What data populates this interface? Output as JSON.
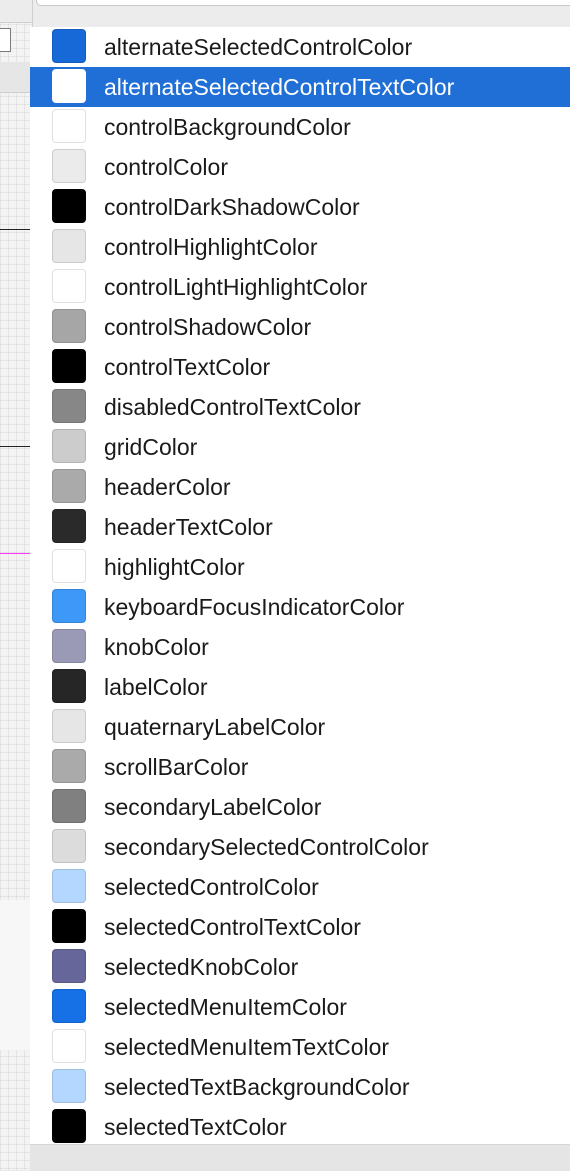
{
  "colors": {
    "selection": "#1f6fd6"
  },
  "items": [
    {
      "label": "alternateSelectedControlColor",
      "swatch": "#1769d8"
    },
    {
      "label": "alternateSelectedControlTextColor",
      "swatch": "#ffffff",
      "selected": true
    },
    {
      "label": "controlBackgroundColor",
      "swatch": "#ffffff"
    },
    {
      "label": "controlColor",
      "swatch": "#ebebeb"
    },
    {
      "label": "controlDarkShadowColor",
      "swatch": "#000000"
    },
    {
      "label": "controlHighlightColor",
      "swatch": "#e6e6e6"
    },
    {
      "label": "controlLightHighlightColor",
      "swatch": "#ffffff"
    },
    {
      "label": "controlShadowColor",
      "swatch": "#a6a6a6"
    },
    {
      "label": "controlTextColor",
      "swatch": "#000000"
    },
    {
      "label": "disabledControlTextColor",
      "swatch": "#878787"
    },
    {
      "label": "gridColor",
      "swatch": "#cccccc"
    },
    {
      "label": "headerColor",
      "swatch": "#aaaaaa"
    },
    {
      "label": "headerTextColor",
      "swatch": "#2a2a2a"
    },
    {
      "label": "highlightColor",
      "swatch": "#ffffff"
    },
    {
      "label": "keyboardFocusIndicatorColor",
      "swatch": "#3d98f7"
    },
    {
      "label": "knobColor",
      "swatch": "#9a9ab7"
    },
    {
      "label": "labelColor",
      "swatch": "#262626"
    },
    {
      "label": "quaternaryLabelColor",
      "swatch": "#e6e6e6"
    },
    {
      "label": "scrollBarColor",
      "swatch": "#aaaaaa"
    },
    {
      "label": "secondaryLabelColor",
      "swatch": "#808080"
    },
    {
      "label": "secondarySelectedControlColor",
      "swatch": "#dcdcdc"
    },
    {
      "label": "selectedControlColor",
      "swatch": "#b3d7ff"
    },
    {
      "label": "selectedControlTextColor",
      "swatch": "#000000"
    },
    {
      "label": "selectedKnobColor",
      "swatch": "#66669a"
    },
    {
      "label": "selectedMenuItemColor",
      "swatch": "#1671e6"
    },
    {
      "label": "selectedMenuItemTextColor",
      "swatch": "#ffffff"
    },
    {
      "label": "selectedTextBackgroundColor",
      "swatch": "#b3d7ff"
    },
    {
      "label": "selectedTextColor",
      "swatch": "#000000"
    }
  ]
}
